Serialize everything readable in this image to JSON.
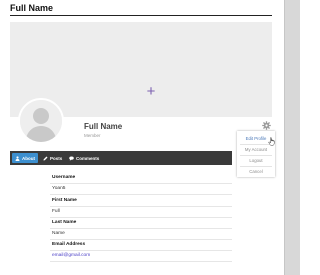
{
  "header": {
    "title": "Full Name"
  },
  "profile": {
    "name": "Full Name",
    "role": "Member"
  },
  "cover": {
    "add_icon": "plus-icon",
    "accent": "#7b5fb0"
  },
  "settings_menu": {
    "icon": "gear-icon",
    "items": [
      {
        "label": "Edit Profile",
        "active": true
      },
      {
        "label": "My Account",
        "active": false
      },
      {
        "label": "Logout",
        "active": false
      },
      {
        "label": "Cancel",
        "active": false
      }
    ]
  },
  "tabs": [
    {
      "label": "About",
      "icon": "user-icon",
      "active": true
    },
    {
      "label": "Posts",
      "icon": "pencil-icon",
      "active": false
    },
    {
      "label": "Comments",
      "icon": "comment-icon",
      "active": false
    }
  ],
  "about": {
    "fields": [
      {
        "label": "Username",
        "value": "Yoan5"
      },
      {
        "label": "First Name",
        "value": "Full"
      },
      {
        "label": "Last Name",
        "value": "Name"
      },
      {
        "label": "Email Address",
        "value": "email@gmail.com"
      }
    ]
  },
  "colors": {
    "tabbar_bg": "#3a3a3a",
    "tab_active": "#3c8fcf",
    "link": "#4b3fc7",
    "menu_active": "#4a78b8"
  }
}
